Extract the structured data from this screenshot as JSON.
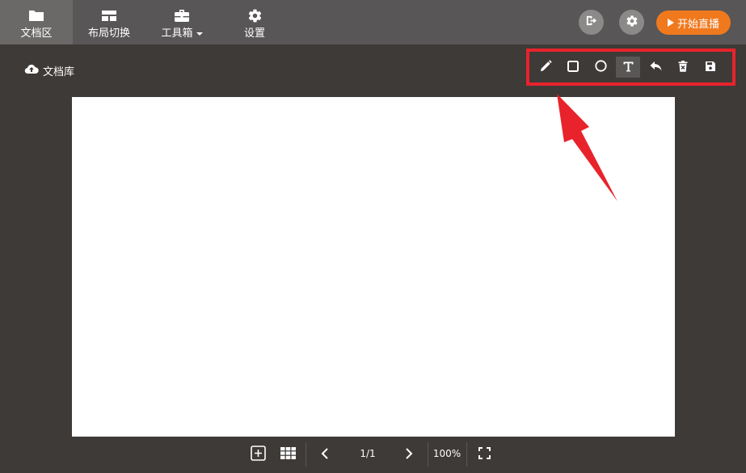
{
  "nav": {
    "items": [
      {
        "label": "文档区",
        "icon": "folder-icon",
        "active": true
      },
      {
        "label": "布局切换",
        "icon": "layout-icon",
        "active": false
      },
      {
        "label": "工具箱",
        "icon": "toolbox-icon",
        "active": false,
        "has_dropdown": true
      },
      {
        "label": "设置",
        "icon": "gear-icon",
        "active": false
      }
    ]
  },
  "header_actions": {
    "exit_icon": "exit-icon",
    "settings_icon": "gear-icon",
    "live_label": "开始直播",
    "live_color": "#f0791e"
  },
  "doc_library": {
    "label": "文档库",
    "icon": "cloud-upload-icon"
  },
  "drawing_tools": [
    {
      "name": "pencil",
      "icon": "pencil-icon"
    },
    {
      "name": "rectangle",
      "icon": "square-icon"
    },
    {
      "name": "circle",
      "icon": "circle-icon"
    },
    {
      "name": "text",
      "icon": "text-icon",
      "selected": true
    },
    {
      "name": "undo",
      "icon": "undo-icon"
    },
    {
      "name": "clear",
      "icon": "trash-icon"
    },
    {
      "name": "save",
      "icon": "save-icon"
    }
  ],
  "highlight_color": "#e8232b",
  "pagination": {
    "current": "1/1",
    "zoom": "100%"
  }
}
